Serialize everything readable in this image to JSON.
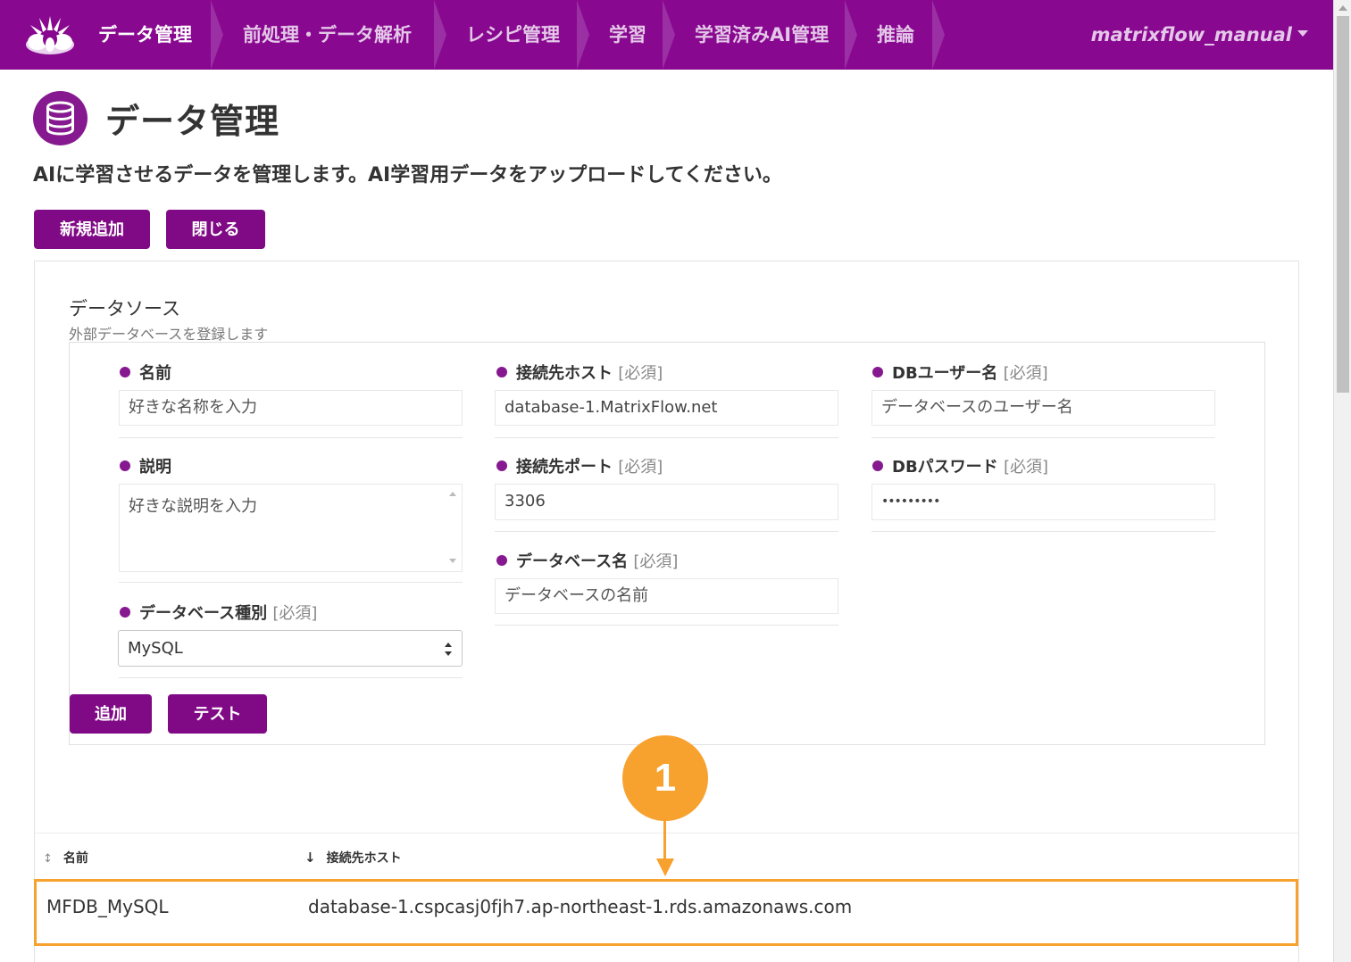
{
  "nav": {
    "logo": "matrixflow-logo-icon",
    "items": [
      {
        "label": "データ管理",
        "active": true
      },
      {
        "label": "前処理・データ解析",
        "active": false
      },
      {
        "label": "レシピ管理",
        "active": false
      },
      {
        "label": "学習",
        "active": false
      },
      {
        "label": "学習済みAI管理",
        "active": false
      },
      {
        "label": "推論",
        "active": false
      }
    ],
    "user": "matrixflow_manual",
    "colors": {
      "bar": "#88088f",
      "active_text": "#ffffff",
      "inactive_text": "#e4c7e8",
      "chevron": "#9b2fa4"
    }
  },
  "page": {
    "icon": "database-icon",
    "title": "データ管理",
    "description": "AIに学習させるデータを管理します。AI学習用データをアップロードしてください。",
    "buttons": {
      "new": "新規追加",
      "close": "閉じる"
    }
  },
  "datasource": {
    "title": "データソース",
    "subtitle": "外部データベースを登録します",
    "fields": {
      "name": {
        "label": "名前",
        "required": "",
        "placeholder": "好きな名称を入力"
      },
      "description": {
        "label": "説明",
        "required": "",
        "placeholder": "好きな説明を入力"
      },
      "db_type": {
        "label": "データベース種別",
        "required": "[必須]",
        "value": "MySQL"
      },
      "host": {
        "label": "接続先ホスト",
        "required": "[必須]",
        "value": "database-1.MatrixFlow.net"
      },
      "port": {
        "label": "接続先ポート",
        "required": "[必須]",
        "value": "3306"
      },
      "db_name": {
        "label": "データベース名",
        "required": "[必須]",
        "placeholder": "データベースの名前"
      },
      "db_user": {
        "label": "DBユーザー名",
        "required": "[必須]",
        "placeholder": "データベースのユーザー名"
      },
      "db_password": {
        "label": "DBパスワード",
        "required": "[必須]",
        "value": "•••••••••"
      }
    },
    "buttons": {
      "add": "追加",
      "test": "テスト"
    }
  },
  "table": {
    "columns": [
      {
        "label": "名前",
        "sort_icon": "↕"
      },
      {
        "label": "接続先ホスト",
        "sort_icon": "↓"
      }
    ],
    "rows": [
      {
        "name": "MFDB_MySQL",
        "host": "database-1.cspcasj0fjh7.ap-northeast-1.rds.amazonaws.com"
      }
    ]
  },
  "annotation": {
    "badge": "1",
    "color": "#f7a12e"
  }
}
